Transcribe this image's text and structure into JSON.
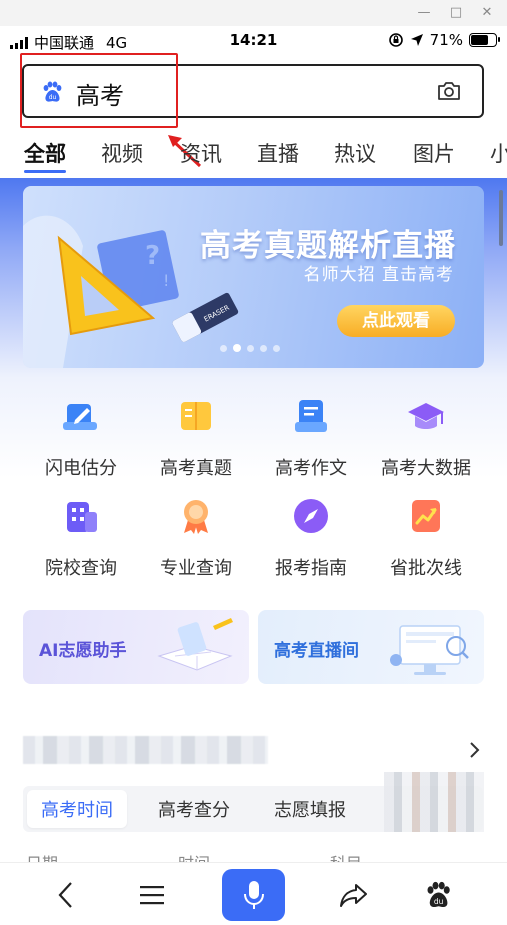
{
  "status_bar": {
    "carrier": "中国联通",
    "network": "4G",
    "time": "14:21",
    "battery": "71%"
  },
  "search": {
    "query": "高考",
    "icon": "baidu-paw-icon",
    "camera_icon": "camera-icon"
  },
  "tabs": [
    {
      "label": "全部"
    },
    {
      "label": "视频"
    },
    {
      "label": "资讯"
    },
    {
      "label": "直播"
    },
    {
      "label": "热议"
    },
    {
      "label": "图片"
    },
    {
      "label": "小"
    }
  ],
  "banner": {
    "title": "高考真题解析直播",
    "subtitle": "名师大招 直击高考",
    "cta": "点此观看",
    "eraser_text": "ERASER"
  },
  "tools": [
    {
      "label": "闪电估分",
      "icon": "pencil-note-icon"
    },
    {
      "label": "高考真题",
      "icon": "open-book-icon"
    },
    {
      "label": "高考作文",
      "icon": "document-icon"
    },
    {
      "label": "高考大数据",
      "icon": "graduation-cap-icon"
    },
    {
      "label": "院校查询",
      "icon": "building-icon"
    },
    {
      "label": "专业查询",
      "icon": "medal-icon"
    },
    {
      "label": "报考指南",
      "icon": "compass-icon"
    },
    {
      "label": "省批次线",
      "icon": "trend-chart-icon"
    }
  ],
  "cards": [
    {
      "label": "AI志愿助手"
    },
    {
      "label": "高考直播间"
    }
  ],
  "subtabs": [
    {
      "label": "高考时间"
    },
    {
      "label": "高考查分"
    },
    {
      "label": "志愿填报"
    }
  ],
  "columns": [
    "日期",
    "时间",
    "科目"
  ],
  "colors": {
    "accent": "#3b6cf6",
    "annotation": "#e02020",
    "cta": "#f8ad25"
  }
}
